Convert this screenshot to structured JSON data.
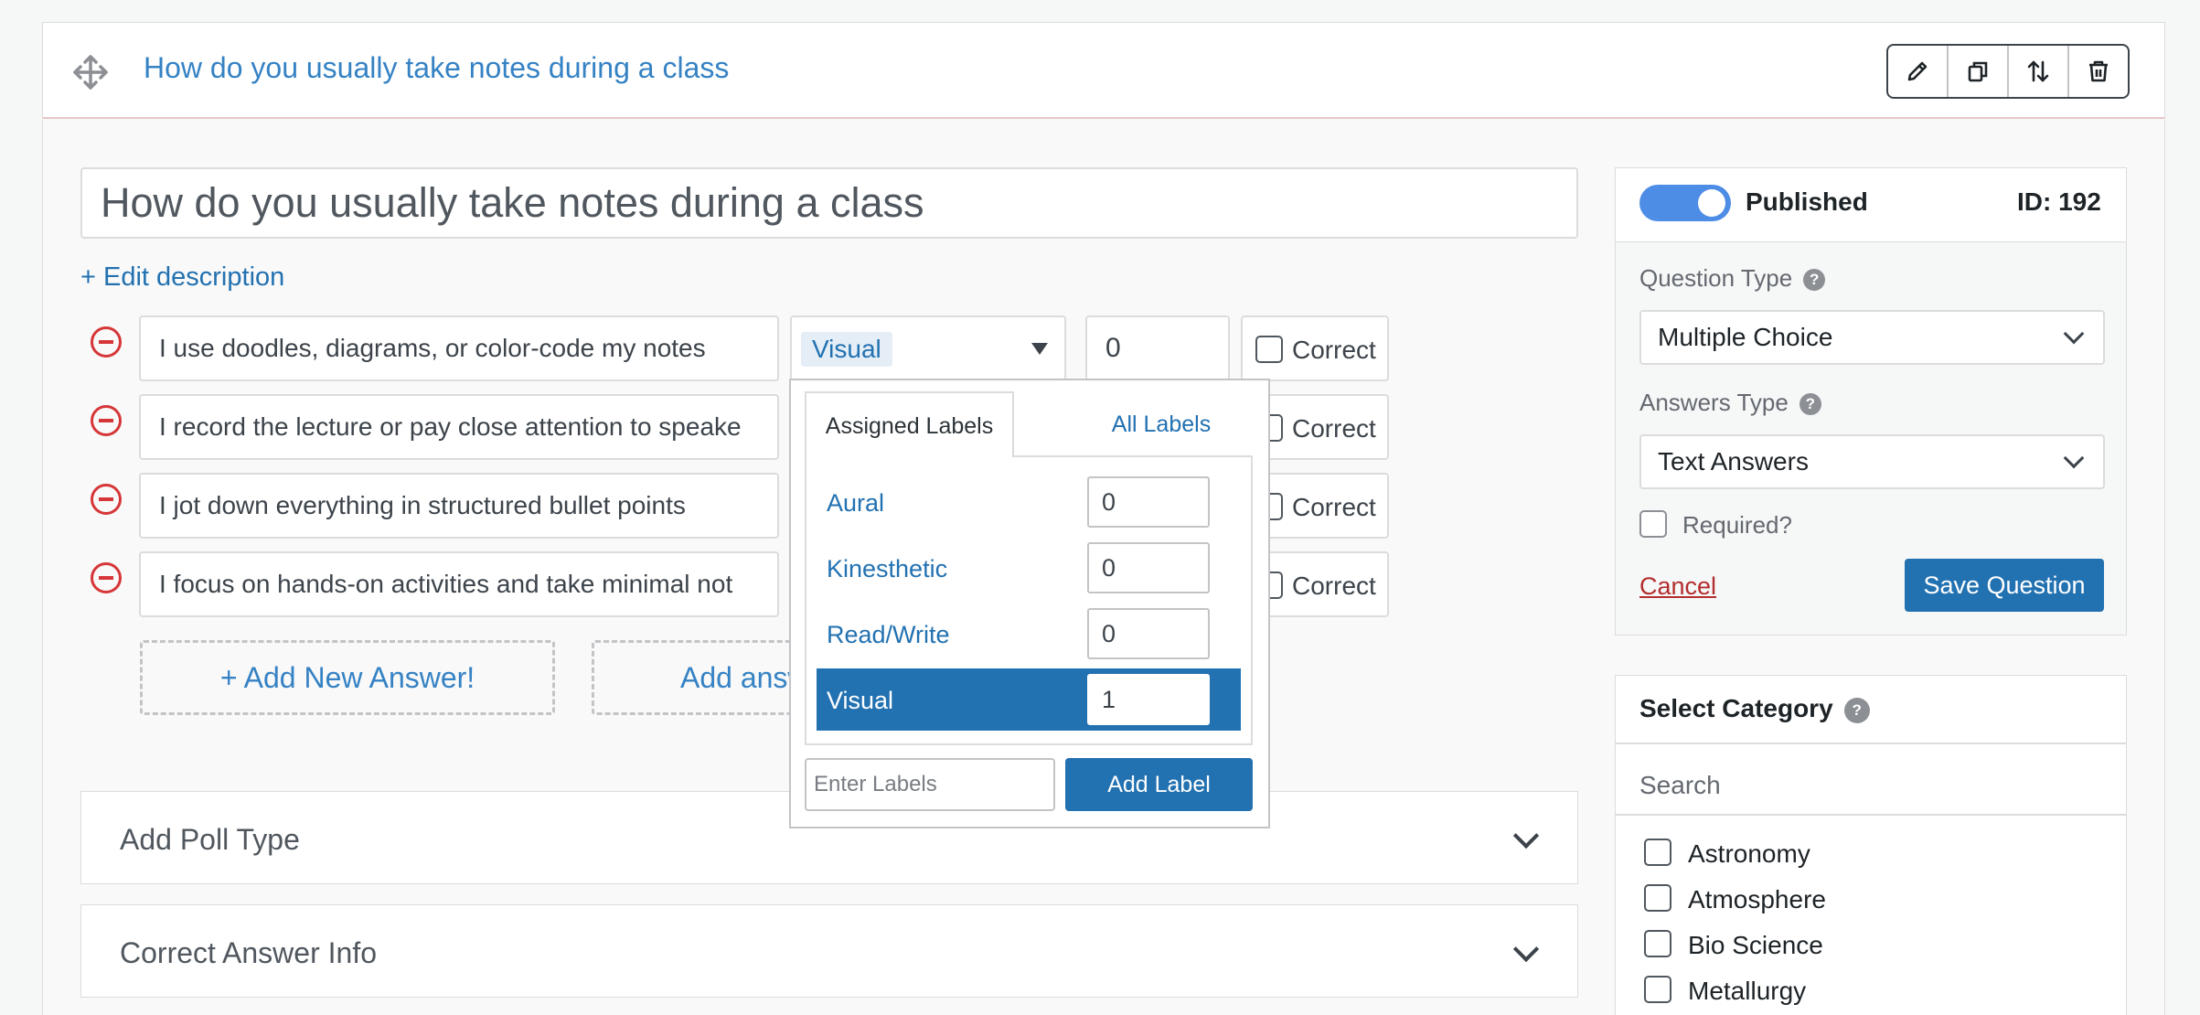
{
  "header": {
    "title": "How do you usually take notes during a class",
    "toolbar": [
      "edit-icon",
      "duplicate-icon",
      "sort-icon",
      "trash-icon"
    ]
  },
  "question": {
    "title": "How do you usually take notes during a class",
    "edit_description": "+ Edit description"
  },
  "answers": [
    {
      "text": "I use doodles, diagrams, or color-code my notes",
      "label": "Visual",
      "points": "0",
      "correct_label": "Correct"
    },
    {
      "text": "I record the lecture or pay close attention to speake",
      "correct_label": "Correct"
    },
    {
      "text": "I jot down everything in structured bullet points",
      "correct_label": "Correct"
    },
    {
      "text": "I focus on hands-on activities and take minimal not",
      "correct_label": "Correct"
    }
  ],
  "add_answer_label": "+ Add New Answer!",
  "add_answers_label": "Add answ",
  "labels_popup": {
    "tab_assigned": "Assigned Labels",
    "tab_all": "All Labels",
    "labels": [
      {
        "name": "Aural",
        "value": "0"
      },
      {
        "name": "Kinesthetic",
        "value": "0"
      },
      {
        "name": "Read/Write",
        "value": "0"
      },
      {
        "name": "Visual",
        "value": "1"
      }
    ],
    "enter_placeholder": "Enter Labels",
    "add_button": "Add Label"
  },
  "accordions": [
    "Add Poll Type",
    "Correct Answer Info"
  ],
  "publish": {
    "status": "Published",
    "id": "ID: 192",
    "question_type_label": "Question Type",
    "question_type_value": "Multiple Choice",
    "answers_type_label": "Answers Type",
    "answers_type_value": "Text Answers",
    "required_label": "Required?",
    "cancel": "Cancel",
    "save": "Save Question",
    "help": "?"
  },
  "category": {
    "title": "Select Category",
    "search_placeholder": "Search",
    "items": [
      "Astronomy",
      "Atmosphere",
      "Bio Science",
      "Metallurgy"
    ]
  },
  "colors": {
    "accent": "#2271b1",
    "link": "#3582c4",
    "danger": "#d63638",
    "toggle": "#4e8de6"
  }
}
